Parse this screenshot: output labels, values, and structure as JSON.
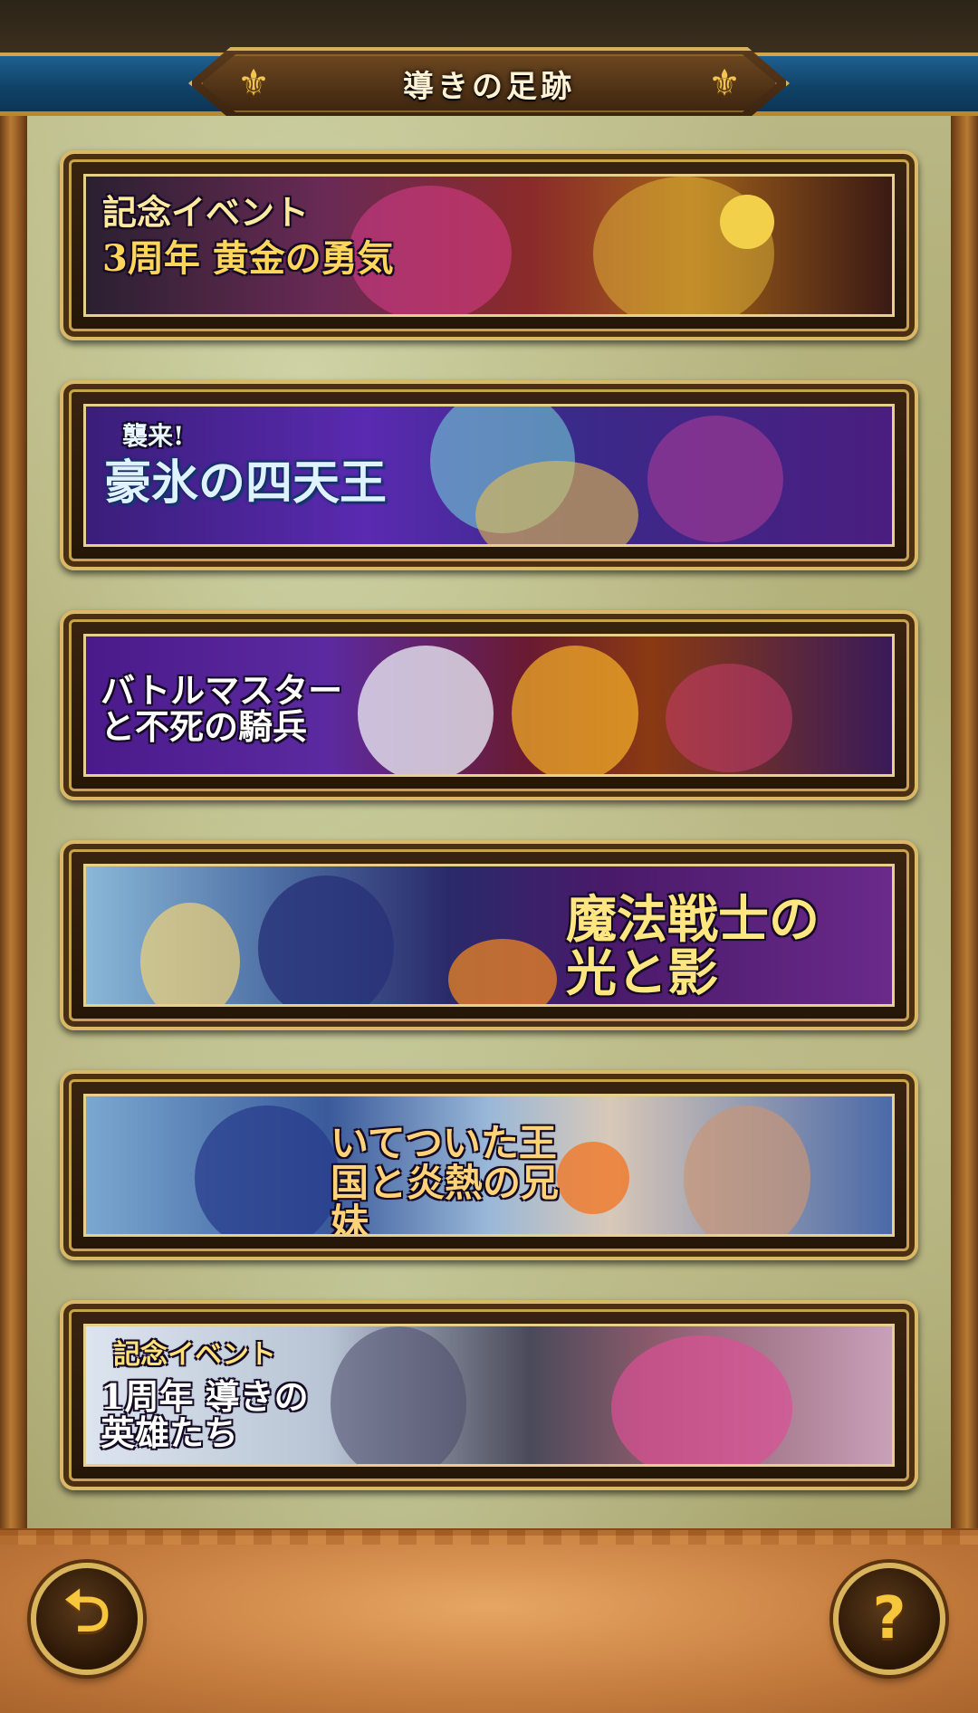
{
  "header": {
    "title": "導きの足跡",
    "ornament_icon": "fleur-de-lis-icon"
  },
  "banners": [
    {
      "title": "3周年 黄金の勇気",
      "subtitle": "記念イベント"
    },
    {
      "title": "豪氷の四天王",
      "subtitle": "襲来!"
    },
    {
      "title": "バトルマスターと不死の騎兵",
      "subtitle": ""
    },
    {
      "title": "魔法戦士の光と影",
      "subtitle": ""
    },
    {
      "title": "いてついた王国と炎熱の兄妹",
      "subtitle": ""
    },
    {
      "title": "1周年 導きの英雄たち",
      "subtitle": "記念イベント"
    }
  ],
  "footer": {
    "back_icon": "back-arrow-icon",
    "help_label": "?",
    "back_label": "⮌"
  },
  "colors": {
    "gold": "#d9b867",
    "header_blue": "#1e5f8f",
    "button_glyph": "#f6c63c"
  }
}
